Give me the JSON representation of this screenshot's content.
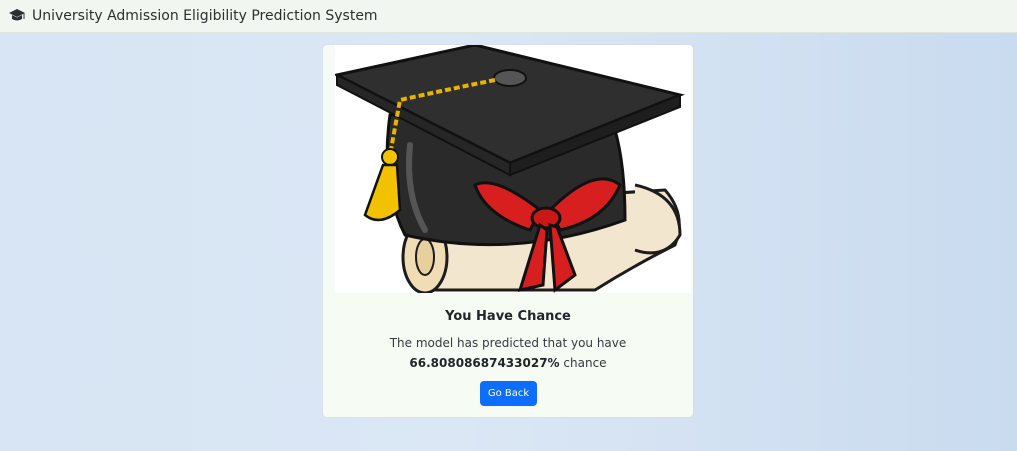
{
  "navbar": {
    "brand_icon": "graduation-cap-icon",
    "title": "University Admission Eligibility Prediction System"
  },
  "result": {
    "image": "graduation-cap-diploma-illustration",
    "title": "You Have Chance",
    "message": "The model has predicted that you have",
    "percentage": "66.80808687433027%",
    "suffix": "chance",
    "button_label": "Go Back"
  },
  "colors": {
    "primary_button": "#0d6efd",
    "navbar_bg": "#f2f6f1"
  }
}
